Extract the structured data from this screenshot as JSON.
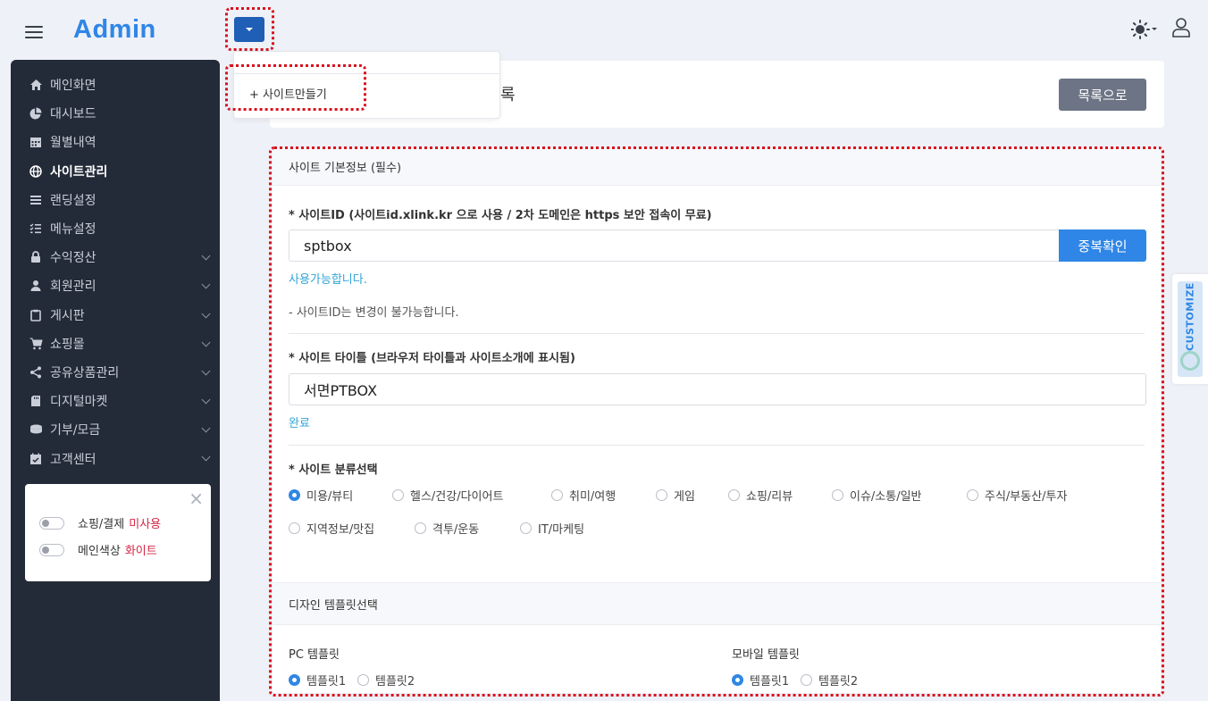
{
  "app": {
    "brand": "Admin"
  },
  "dropdown": {
    "item": "+ 사이트만들기"
  },
  "sidebar": {
    "items": [
      {
        "label": "메인화면",
        "icon": "home-icon",
        "chevron": false,
        "active": false
      },
      {
        "label": "대시보드",
        "icon": "pie-chart-icon",
        "chevron": false,
        "active": false
      },
      {
        "label": "월별내역",
        "icon": "calendar-icon",
        "chevron": false,
        "active": false
      },
      {
        "label": "사이트관리",
        "icon": "globe-icon",
        "chevron": false,
        "active": true
      },
      {
        "label": "랜딩설정",
        "icon": "list-icon",
        "chevron": false,
        "active": false
      },
      {
        "label": "메뉴설정",
        "icon": "checklist-icon",
        "chevron": false,
        "active": false
      },
      {
        "label": "수익정산",
        "icon": "lock-icon",
        "chevron": true,
        "active": false
      },
      {
        "label": "회원관리",
        "icon": "user-icon",
        "chevron": true,
        "active": false
      },
      {
        "label": "게시판",
        "icon": "clipboard-icon",
        "chevron": true,
        "active": false
      },
      {
        "label": "쇼핑몰",
        "icon": "cart-icon",
        "chevron": true,
        "active": false
      },
      {
        "label": "공유상품관리",
        "icon": "share-icon",
        "chevron": true,
        "active": false
      },
      {
        "label": "디지털마켓",
        "icon": "sd-card-icon",
        "chevron": true,
        "active": false
      },
      {
        "label": "기부/모금",
        "icon": "coins-icon",
        "chevron": true,
        "active": false
      },
      {
        "label": "고객센터",
        "icon": "calendar-check-icon",
        "chevron": true,
        "active": false
      }
    ],
    "settings": {
      "shopping_label": "쇼핑/결제",
      "shopping_value": "미사용",
      "color_label": "메인색상",
      "color_value": "화이트"
    }
  },
  "header": {
    "title": "록",
    "list_button": "목록으로"
  },
  "form": {
    "section_basic": "사이트 기본정보 (필수)",
    "site_id": {
      "label": "* 사이트ID (사이트id.xlink.kr 으로 사용 / 2차 도메인은 https 보안 접속이 무료)",
      "value": "sptbox",
      "check_button": "중복확인",
      "status": "사용가능합니다.",
      "note": "- 사이트ID는 변경이 불가능합니다."
    },
    "site_title": {
      "label": "* 사이트 타이틀 (브라우저 타이틀과 사이트소개에 표시됨)",
      "value": "서면PTBOX",
      "status": "완료"
    },
    "category": {
      "label": "* 사이트 분류선택",
      "options": [
        "미용/뷰티",
        "헬스/건강/다이어트",
        "취미/여행",
        "게임",
        "쇼핑/리뷰",
        "이슈/소통/일반",
        "주식/부동산/투자",
        "지역정보/맛집",
        "격투/운동",
        "IT/마케팅"
      ],
      "selected": "미용/뷰티"
    },
    "section_design": "디자인 템플릿선택",
    "pc_template": {
      "label": "PC 템플릿",
      "options": [
        "템플릿1",
        "템플릿2"
      ],
      "selected": "템플릿1"
    },
    "mobile_template": {
      "label": "모바일 템플릿",
      "options": [
        "템플릿1",
        "템플릿2"
      ],
      "selected": "템플릿1"
    }
  },
  "customize_tab": {
    "label": "CUSTOMIZE"
  },
  "colors": {
    "accent": "#2f86e6",
    "sidebar_bg": "#232b38",
    "highlight_border": "#d8121e",
    "gray_button": "#6c7485"
  }
}
